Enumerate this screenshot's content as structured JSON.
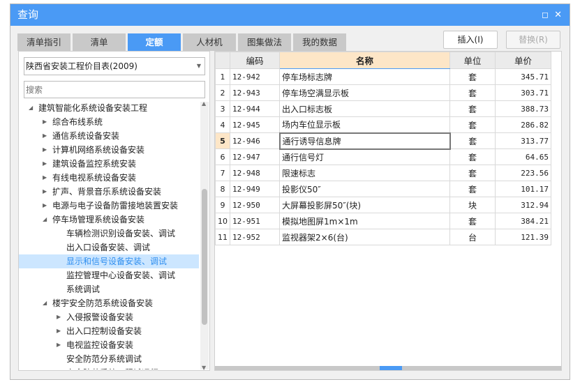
{
  "window": {
    "title": "查询",
    "maximize_icon": "square-icon",
    "close_icon": "close-icon"
  },
  "tabs": [
    {
      "label": "清单指引"
    },
    {
      "label": "清单"
    },
    {
      "label": "定额",
      "active": true
    },
    {
      "label": "人材机"
    },
    {
      "label": "图集做法"
    },
    {
      "label": "我的数据"
    }
  ],
  "buttons": {
    "insert": "插入(I)",
    "replace": "替换(R)"
  },
  "left": {
    "library": "陕西省安装工程价目表(2009)",
    "search_placeholder": "搜索",
    "tree": [
      {
        "label": "建筑智能化系统设备安装工程",
        "level": 0,
        "toggle": "expanded"
      },
      {
        "label": "综合布线系统",
        "level": 1,
        "toggle": "collapsed"
      },
      {
        "label": "通信系统设备安装",
        "level": 1,
        "toggle": "collapsed"
      },
      {
        "label": "计算机网络系统设备安装",
        "level": 1,
        "toggle": "collapsed"
      },
      {
        "label": "建筑设备监控系统安装",
        "level": 1,
        "toggle": "collapsed"
      },
      {
        "label": "有线电视系统设备安装",
        "level": 1,
        "toggle": "collapsed"
      },
      {
        "label": "扩声、背景音乐系统设备安装",
        "level": 1,
        "toggle": "collapsed"
      },
      {
        "label": "电源与电子设备防雷接地装置安装",
        "level": 1,
        "toggle": "collapsed"
      },
      {
        "label": "停车场管理系统设备安装",
        "level": 1,
        "toggle": "expanded"
      },
      {
        "label": "车辆检测识别设备安装、调试",
        "level": 2,
        "toggle": "none"
      },
      {
        "label": "出入口设备安装、调试",
        "level": 2,
        "toggle": "none"
      },
      {
        "label": "显示和信号设备安装、调试",
        "level": 2,
        "toggle": "none",
        "selected": true
      },
      {
        "label": "监控管理中心设备安装、调试",
        "level": 2,
        "toggle": "none"
      },
      {
        "label": "系统调试",
        "level": 2,
        "toggle": "none"
      },
      {
        "label": "楼宇安全防范系统设备安装",
        "level": 1,
        "toggle": "expanded"
      },
      {
        "label": "入侵报警设备安装",
        "level": 2,
        "toggle": "collapsed"
      },
      {
        "label": "出入口控制设备安装",
        "level": 2,
        "toggle": "collapsed"
      },
      {
        "label": "电视监控设备安装",
        "level": 2,
        "toggle": "collapsed"
      },
      {
        "label": "安全防范分系统调试",
        "level": 2,
        "toggle": "none"
      },
      {
        "label": "安全防范系统工程试运行",
        "level": 2,
        "toggle": "none"
      }
    ]
  },
  "table": {
    "headers": [
      "",
      "编码",
      "名称",
      "单位",
      "单价"
    ],
    "current_row": 5,
    "rows": [
      [
        "1",
        "12-942",
        "停车场标志牌",
        "套",
        "345.71"
      ],
      [
        "2",
        "12-943",
        "停车场空满显示板",
        "套",
        "303.71"
      ],
      [
        "3",
        "12-944",
        "出入口标志板",
        "套",
        "388.73"
      ],
      [
        "4",
        "12-945",
        "场内车位显示板",
        "套",
        "286.82"
      ],
      [
        "5",
        "12-946",
        "通行诱导信息牌",
        "套",
        "313.77"
      ],
      [
        "6",
        "12-947",
        "通行信号灯",
        "套",
        "64.65"
      ],
      [
        "7",
        "12-948",
        "限速标志",
        "套",
        "223.56"
      ],
      [
        "8",
        "12-949",
        "投影仪50″",
        "套",
        "101.17"
      ],
      [
        "9",
        "12-950",
        "大屏幕投影屏50″(块)",
        "块",
        "312.94"
      ],
      [
        "10",
        "12-951",
        "模拟地图屏1m×1m",
        "套",
        "384.21"
      ],
      [
        "11",
        "12-952",
        "监视器架2×6(台)",
        "台",
        "121.39"
      ]
    ]
  },
  "colors": {
    "accent": "#4a9af5",
    "header_highlight": "#fde6c7",
    "selection": "#cce6ff"
  }
}
